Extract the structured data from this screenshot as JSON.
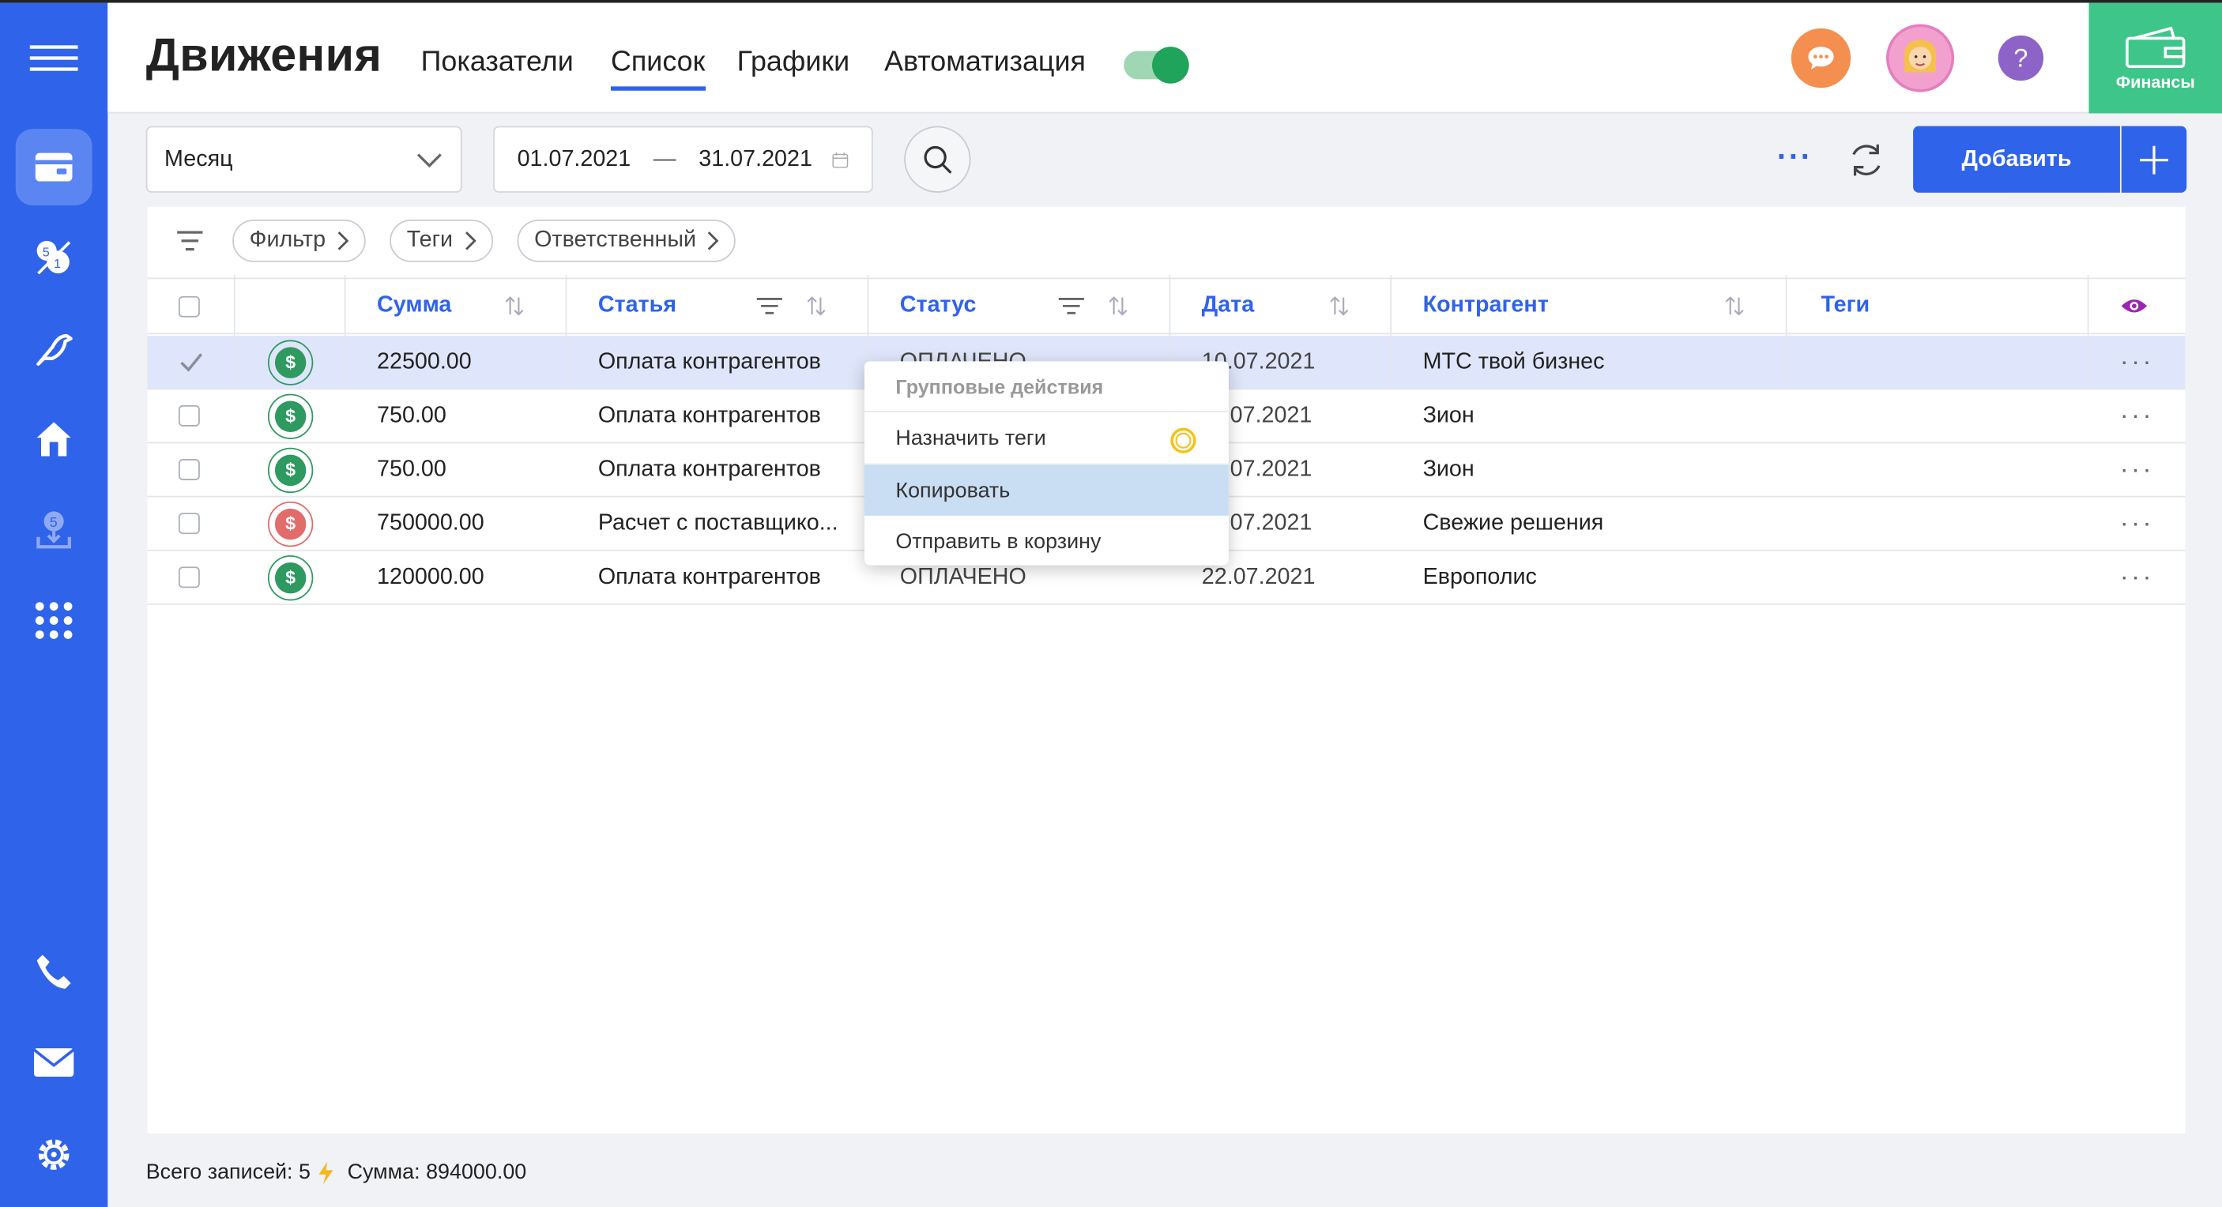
{
  "header": {
    "title": "Движения",
    "tabs": [
      {
        "label": "Показатели"
      },
      {
        "label": "Список"
      },
      {
        "label": "Графики"
      },
      {
        "label": "Автоматизация"
      }
    ],
    "active_tab": "Список",
    "automation_toggle": "on",
    "help_label": "?",
    "section_label": "Финансы"
  },
  "toolbar": {
    "period": "Месяц",
    "date_from": "01.07.2021",
    "date_separator": "—",
    "date_to": "31.07.2021",
    "add_label": "Добавить",
    "more_label": "···"
  },
  "filters": [
    {
      "label": "Фильтр"
    },
    {
      "label": "Теги"
    },
    {
      "label": "Ответственный"
    }
  ],
  "table": {
    "columns": [
      "Сумма",
      "Статья",
      "Статус",
      "Дата",
      "Контрагент",
      "Теги"
    ],
    "rows": [
      {
        "amount": "22500.00",
        "article": "Оплата контрагентов",
        "status": "ОПЛАЧЕНО",
        "date": "10.07.2021",
        "date_visible": "10.07.2021",
        "counterparty": "МТС твой бизнес",
        "tags": "",
        "coin": "green",
        "selected": true
      },
      {
        "amount": "750.00",
        "article": "Оплата контрагентов",
        "status": "",
        "date_visible": "07.2021",
        "counterparty": "Зион",
        "tags": "",
        "coin": "green",
        "selected": false
      },
      {
        "amount": "750.00",
        "article": "Оплата контрагентов",
        "status": "",
        "date_visible": "07.2021",
        "counterparty": "Зион",
        "tags": "",
        "coin": "green",
        "selected": false
      },
      {
        "amount": "750000.00",
        "article": "Расчет с поставщико...",
        "status": "",
        "date_visible": "07.2021",
        "counterparty": "Свежие решения",
        "tags": "",
        "coin": "red",
        "selected": false
      },
      {
        "amount": "120000.00",
        "article": "Оплата контрагентов",
        "status": "ОПЛАЧЕНО",
        "date_visible": "22.07.2021",
        "counterparty": "Европолис",
        "tags": "",
        "coin": "green",
        "selected": false
      }
    ],
    "row_menu_label": "···",
    "coin_symbol": "$"
  },
  "context_menu": {
    "header": "Групповые действия",
    "items": [
      "Назначить теги",
      "Копировать",
      "Отправить в корзину"
    ],
    "highlighted": "Копировать"
  },
  "footer": {
    "records_label": "Всего записей: 5",
    "sum_label": "Сумма: 894000.00"
  },
  "colors": {
    "sidebar": "#2f63ea",
    "accent": "#2f63ea",
    "finance_tab": "#3ec58a",
    "toggle": "#20a35a",
    "coin_green": "#2f9a5f",
    "coin_red": "#e26b6b",
    "selected_row": "#dfe6fb"
  },
  "icons": [
    "menu-icon",
    "wallet-icon",
    "badge-icon",
    "bird-icon",
    "home-icon",
    "download-icon",
    "grid-icon",
    "phone-icon",
    "mail-icon",
    "settings-icon",
    "chat-icon",
    "avatar",
    "help-icon",
    "calendar-icon",
    "search-icon",
    "refresh-icon",
    "plus-icon",
    "filter-icon",
    "sort-icon",
    "eye-icon",
    "chevron-right-icon",
    "chevron-down-icon",
    "lightning-icon"
  ]
}
